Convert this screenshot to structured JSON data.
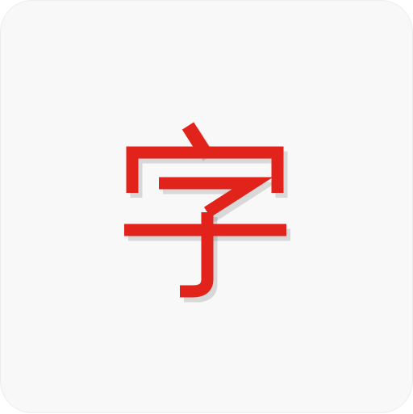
{
  "icon": {
    "name": "zi-character-icon",
    "character": "字",
    "glyph_color": "#e2231c",
    "background_color": "#f8f8f8"
  }
}
